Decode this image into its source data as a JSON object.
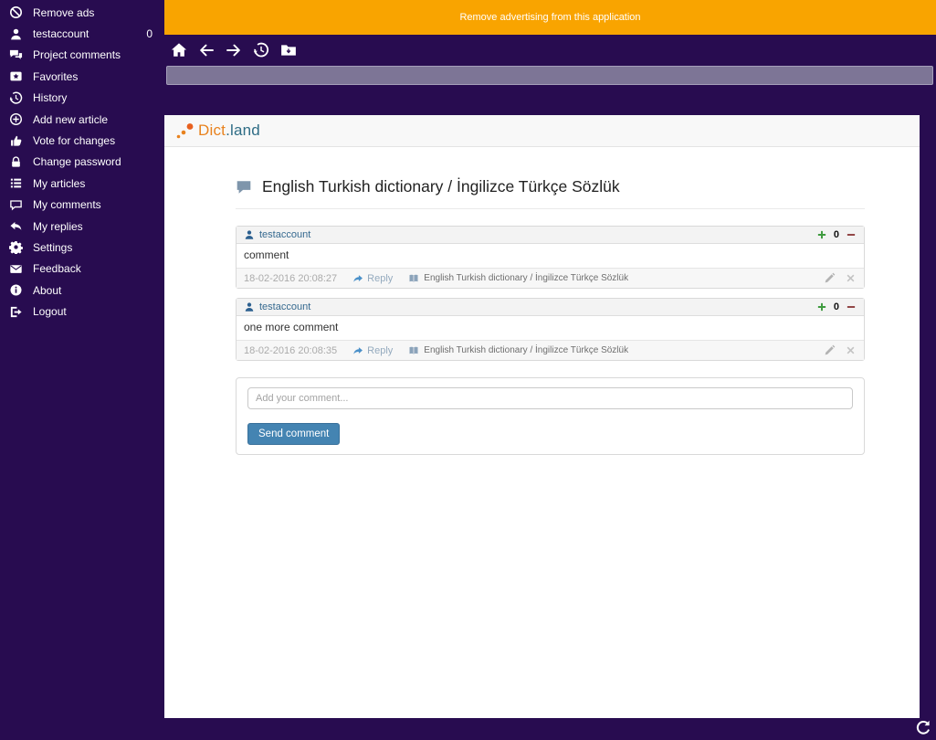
{
  "sidebar": {
    "items": [
      {
        "label": "Remove ads",
        "icon": "no-ads-icon"
      },
      {
        "label": "testaccount",
        "icon": "user-icon",
        "badge": "0"
      },
      {
        "label": "Project comments",
        "icon": "project-comments-icon"
      },
      {
        "label": "Favorites",
        "icon": "favorites-icon"
      },
      {
        "label": "History",
        "icon": "history-icon"
      },
      {
        "label": "Add new article",
        "icon": "add-article-icon"
      },
      {
        "label": "Vote for changes",
        "icon": "vote-icon"
      },
      {
        "label": "Change password",
        "icon": "lock-icon"
      },
      {
        "label": "My articles",
        "icon": "articles-icon"
      },
      {
        "label": "My comments",
        "icon": "comment-icon"
      },
      {
        "label": "My replies",
        "icon": "reply-icon"
      },
      {
        "label": "Settings",
        "icon": "gear-icon"
      },
      {
        "label": "Feedback",
        "icon": "mail-icon"
      },
      {
        "label": "About",
        "icon": "info-icon"
      },
      {
        "label": "Logout",
        "icon": "logout-icon"
      }
    ]
  },
  "banner": {
    "label": "Remove advertising from this application"
  },
  "toolbar": {
    "icons": [
      "home-icon",
      "back-icon",
      "forward-icon",
      "history-icon",
      "folder-download-icon"
    ]
  },
  "address_bar": {
    "value": ""
  },
  "page": {
    "logo": {
      "orange": "Dict",
      "teal": ".land"
    },
    "title": "English Turkish dictionary / İngilizce Türkçe Sözlük",
    "comments": [
      {
        "author": "testaccount",
        "score": "0",
        "body": "comment",
        "timestamp": "18-02-2016 20:08:27",
        "reply_label": "Reply",
        "article_link": "English Turkish dictionary / İngilizce Türkçe Sözlük"
      },
      {
        "author": "testaccount",
        "score": "0",
        "body": "one more comment",
        "timestamp": "18-02-2016 20:08:35",
        "reply_label": "Reply",
        "article_link": "English Turkish dictionary / İngilizce Türkçe Sözlük"
      }
    ],
    "comment_form": {
      "placeholder": "Add your comment...",
      "submit_label": "Send comment"
    }
  },
  "colors": {
    "background": "#280c50",
    "banner": "#f9a400",
    "logo_orange": "#e8821e",
    "logo_teal": "#2f6d86",
    "link_blue": "#35698f",
    "button_blue": "#4484b2",
    "vote_up_green": "#3f9b3f",
    "vote_down_red": "#8f4343"
  }
}
